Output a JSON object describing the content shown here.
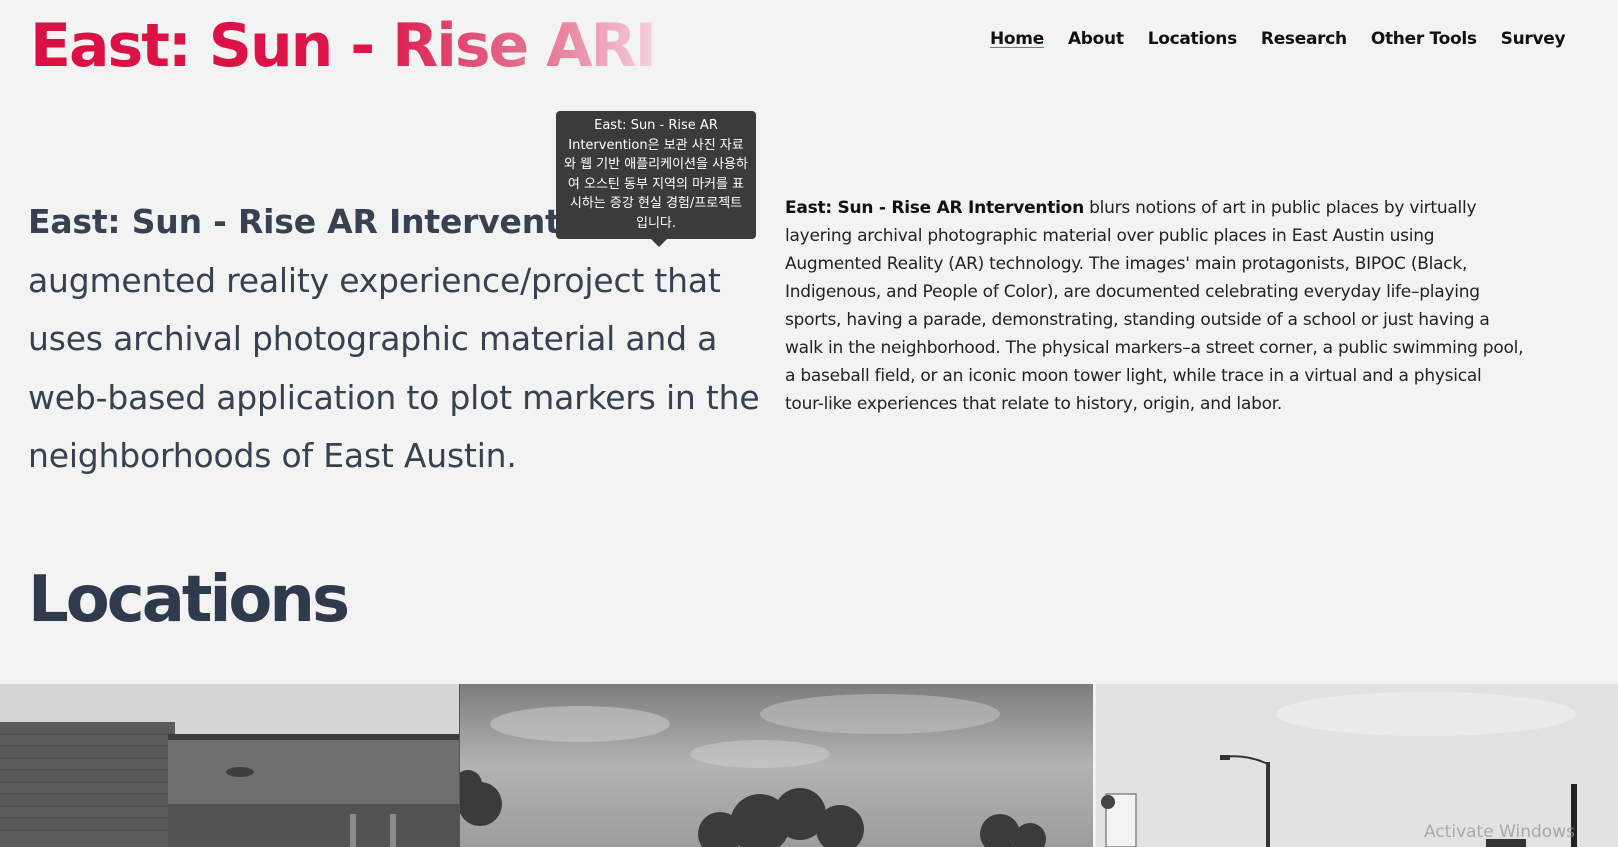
{
  "header": {
    "logo": "East: Sun - Rise ARI"
  },
  "nav": {
    "items": [
      {
        "label": "Home"
      },
      {
        "label": "About"
      },
      {
        "label": "Locations"
      },
      {
        "label": "Research"
      },
      {
        "label": "Other Tools"
      },
      {
        "label": "Survey"
      }
    ]
  },
  "tooltip": {
    "text": "East: Sun - Rise AR Intervention은 보관 사진 자료와 웹 기반 애플리케이션을 사용하여 오스틴 동부 지역의 마커를 표시하는 증강 현실 경험/프로젝트입니다."
  },
  "hero": {
    "left_bold": "East: Sun - Rise AR Intervention",
    "left_rest": " augmented reality experience/project that uses archival photographic material and a web-based application to plot markers in the neighborhoods of East Austin.",
    "right_bold": "East: Sun - Rise AR Intervention",
    "right_rest": " blurs notions of art in public places by virtually layering archival photographic material over public places in East Austin using Augmented Reality (AR) technology. The images' main protagonists, BIPOC (Black, Indigenous, and People of Color), are documented celebrating everyday life–playing sports, having a parade, demonstrating, standing outside of a school or just having a walk in the neighborhood. The physical markers–a street corner, a public swimming pool, a baseball field, or an iconic moon tower light, while trace in a virtual and a physical tour-like experiences that relate to history, origin, and labor."
  },
  "locations": {
    "title": "Locations"
  },
  "os": {
    "watermark": "Activate Windows"
  },
  "colors": {
    "logo_red": "#dc0f42",
    "text_slate": "#374151",
    "background": "#f2f3f2",
    "tooltip_bg": "#3a3c3b",
    "nav_underline": "#0ea5b7"
  }
}
